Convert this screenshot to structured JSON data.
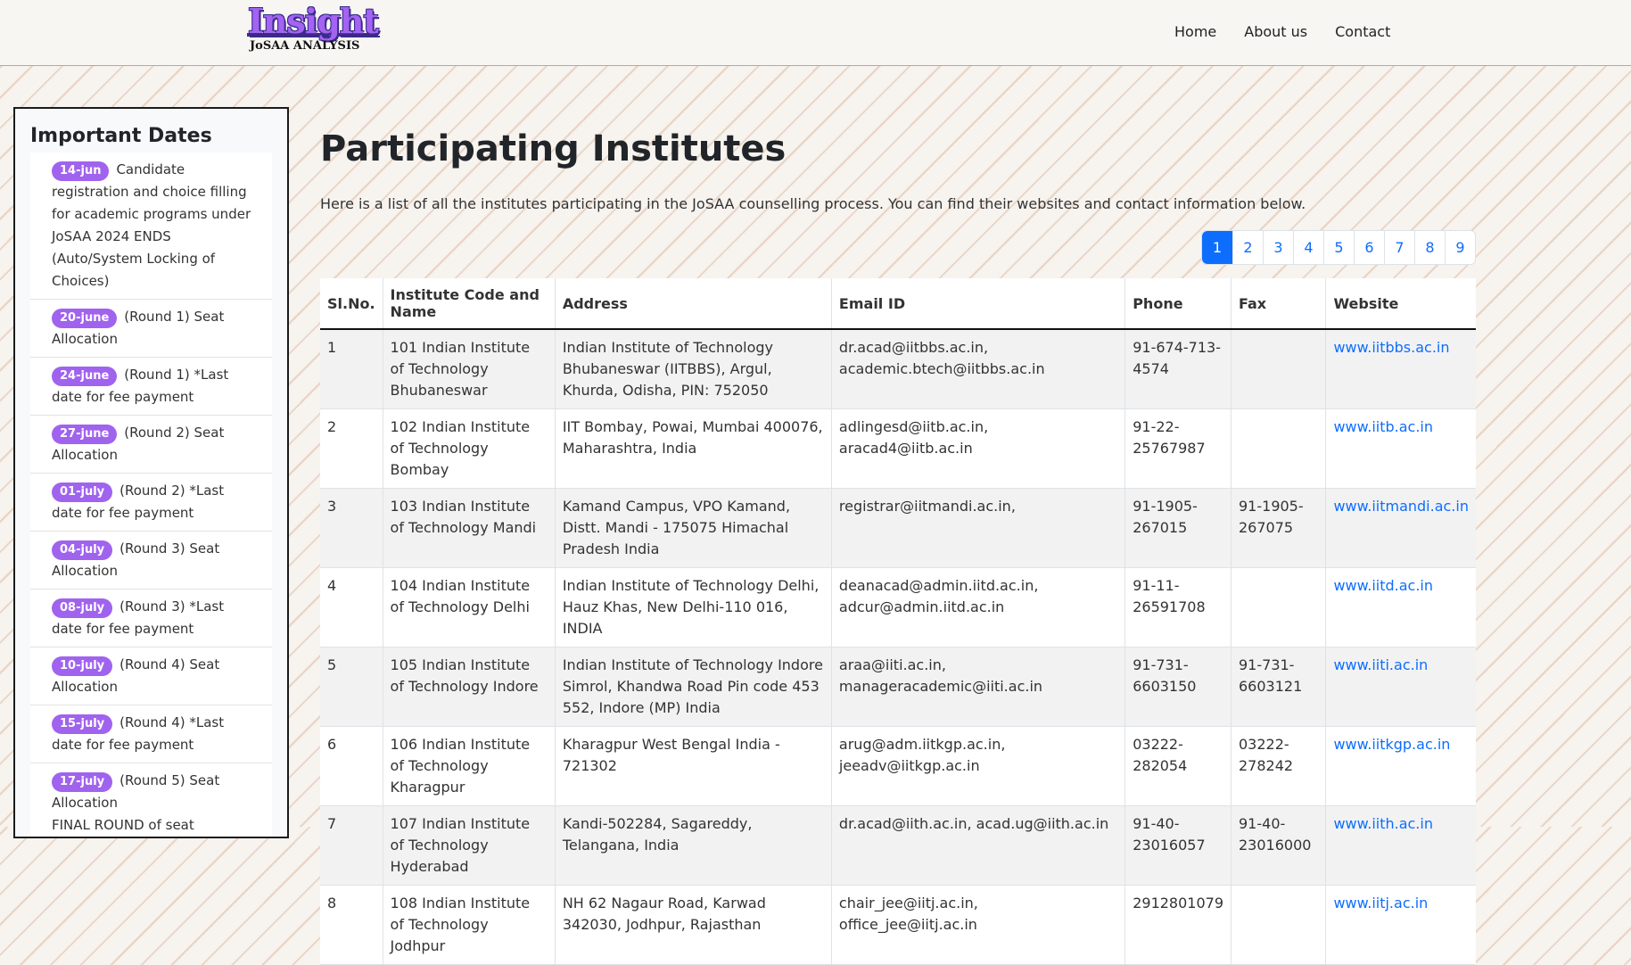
{
  "brand": {
    "logo": "Insight",
    "subtitle": "JoSAA ANALYSIS"
  },
  "nav": {
    "items": [
      "Home",
      "About us",
      "Contact"
    ]
  },
  "sidebar": {
    "title": "Important Dates",
    "items": [
      {
        "date": "14-jun",
        "text": "Candidate registration and choice filling for academic programs under JoSAA 2024 ENDS (Auto/System Locking of Choices)"
      },
      {
        "date": "20-june",
        "text": "(Round 1) Seat Allocation"
      },
      {
        "date": "24-june",
        "text": "(Round 1) *Last date for fee payment"
      },
      {
        "date": "27-june",
        "text": "(Round 2) Seat Allocation"
      },
      {
        "date": "01-july",
        "text": "(Round 2) *Last date for fee payment"
      },
      {
        "date": "04-july",
        "text": "(Round 3) Seat Allocation"
      },
      {
        "date": "08-july",
        "text": "(Round 3) *Last date for fee payment"
      },
      {
        "date": "10-july",
        "text": "(Round 4) Seat Allocation"
      },
      {
        "date": "15-july",
        "text": "(Round 4) *Last date for fee payment"
      },
      {
        "date": "17-july",
        "text": "(Round 5) Seat Allocation",
        "extra": "FINAL ROUND of seat allocation"
      }
    ]
  },
  "main": {
    "title": "Participating Institutes",
    "intro": "Here is a list of all the institutes participating in the JoSAA counselling process. You can find their websites and contact information below.",
    "pagination": {
      "pages": [
        "1",
        "2",
        "3",
        "4",
        "5",
        "6",
        "7",
        "8",
        "9"
      ],
      "active": "1"
    },
    "table": {
      "headers": [
        "Sl.No.",
        "Institute Code and Name",
        "Address",
        "Email ID",
        "Phone",
        "Fax",
        "Website"
      ],
      "rows": [
        [
          "1",
          "101 Indian Institute of Technology Bhubaneswar",
          "Indian Institute of Technology Bhubaneswar (IITBBS), Argul, Khurda, Odisha, PIN: 752050",
          "dr.acad@iitbbs.ac.in, academic.btech@iitbbs.ac.in",
          "91-674-713-4574",
          "",
          "www.iitbbs.ac.in"
        ],
        [
          "2",
          "102 Indian Institute of Technology Bombay",
          "IIT Bombay, Powai, Mumbai 400076, Maharashtra, India",
          "adlingesd@iitb.ac.in, aracad4@iitb.ac.in",
          "91-22-25767987",
          "",
          "www.iitb.ac.in"
        ],
        [
          "3",
          "103 Indian Institute of Technology Mandi",
          "Kamand Campus, VPO Kamand, Distt. Mandi - 175075 Himachal Pradesh India",
          "registrar@iitmandi.ac.in,",
          "91-1905-267015",
          "91-1905-267075",
          "www.iitmandi.ac.in"
        ],
        [
          "4",
          "104 Indian Institute of Technology Delhi",
          "Indian Institute of Technology Delhi, Hauz Khas, New Delhi-110 016, INDIA",
          "deanacad@admin.iitd.ac.in, adcur@admin.iitd.ac.in",
          "91-11-26591708",
          "",
          "www.iitd.ac.in"
        ],
        [
          "5",
          "105 Indian Institute of Technology Indore",
          "Indian Institute of Technology Indore Simrol, Khandwa Road Pin code 453 552, Indore (MP) India",
          "araa@iiti.ac.in, manageracademic@iiti.ac.in",
          "91-731-6603150",
          "91-731-6603121",
          "www.iiti.ac.in"
        ],
        [
          "6",
          "106 Indian Institute of Technology Kharagpur",
          "Kharagpur West Bengal India - 721302",
          "arug@adm.iitkgp.ac.in, jeeadv@iitkgp.ac.in",
          "03222-282054",
          "03222-278242",
          "www.iitkgp.ac.in"
        ],
        [
          "7",
          "107 Indian Institute of Technology Hyderabad",
          "Kandi-502284, Sagareddy, Telangana, India",
          "dr.acad@iith.ac.in, acad.ug@iith.ac.in",
          "91-40-23016057",
          "91-40-23016000",
          "www.iith.ac.in"
        ],
        [
          "8",
          "108 Indian Institute of Technology Jodhpur",
          "NH 62 Nagaur Road, Karwad 342030, Jodhpur, Rajasthan",
          "chair_jee@iitj.ac.in, office_jee@iitj.ac.in",
          "2912801079",
          "",
          "www.iitj.ac.in"
        ]
      ]
    }
  },
  "colors": {
    "accent": "#a063ee",
    "link": "#0d6efd",
    "brand": "#a463f2"
  }
}
